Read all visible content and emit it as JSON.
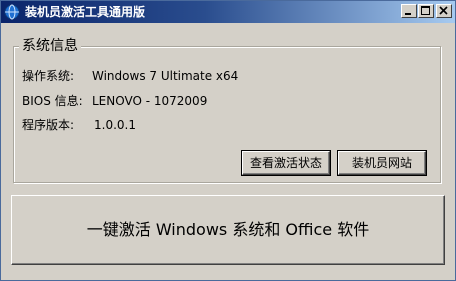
{
  "window": {
    "title": "装机员激活工具通用版",
    "icon": "app-globe-icon",
    "controls": [
      "minimize-icon",
      "maximize-icon",
      "close-icon"
    ]
  },
  "system_info": {
    "legend": "系统信息",
    "rows": [
      {
        "label": "操作系统:",
        "value": "Windows 7 Ultimate x64"
      },
      {
        "label": "BIOS 信息:",
        "value": "LENOVO - 1072009"
      },
      {
        "label": "程序版本:",
        "value": "1.0.0.1"
      }
    ]
  },
  "buttons": {
    "check_status": "查看激活状态",
    "website": "装机员网站",
    "activate": "一键激活 Windows 系统和 Office 软件"
  },
  "colors": {
    "title_gradient_start": "#0a246a",
    "title_gradient_end": "#a6caf0",
    "face": "#d4d0c8"
  }
}
